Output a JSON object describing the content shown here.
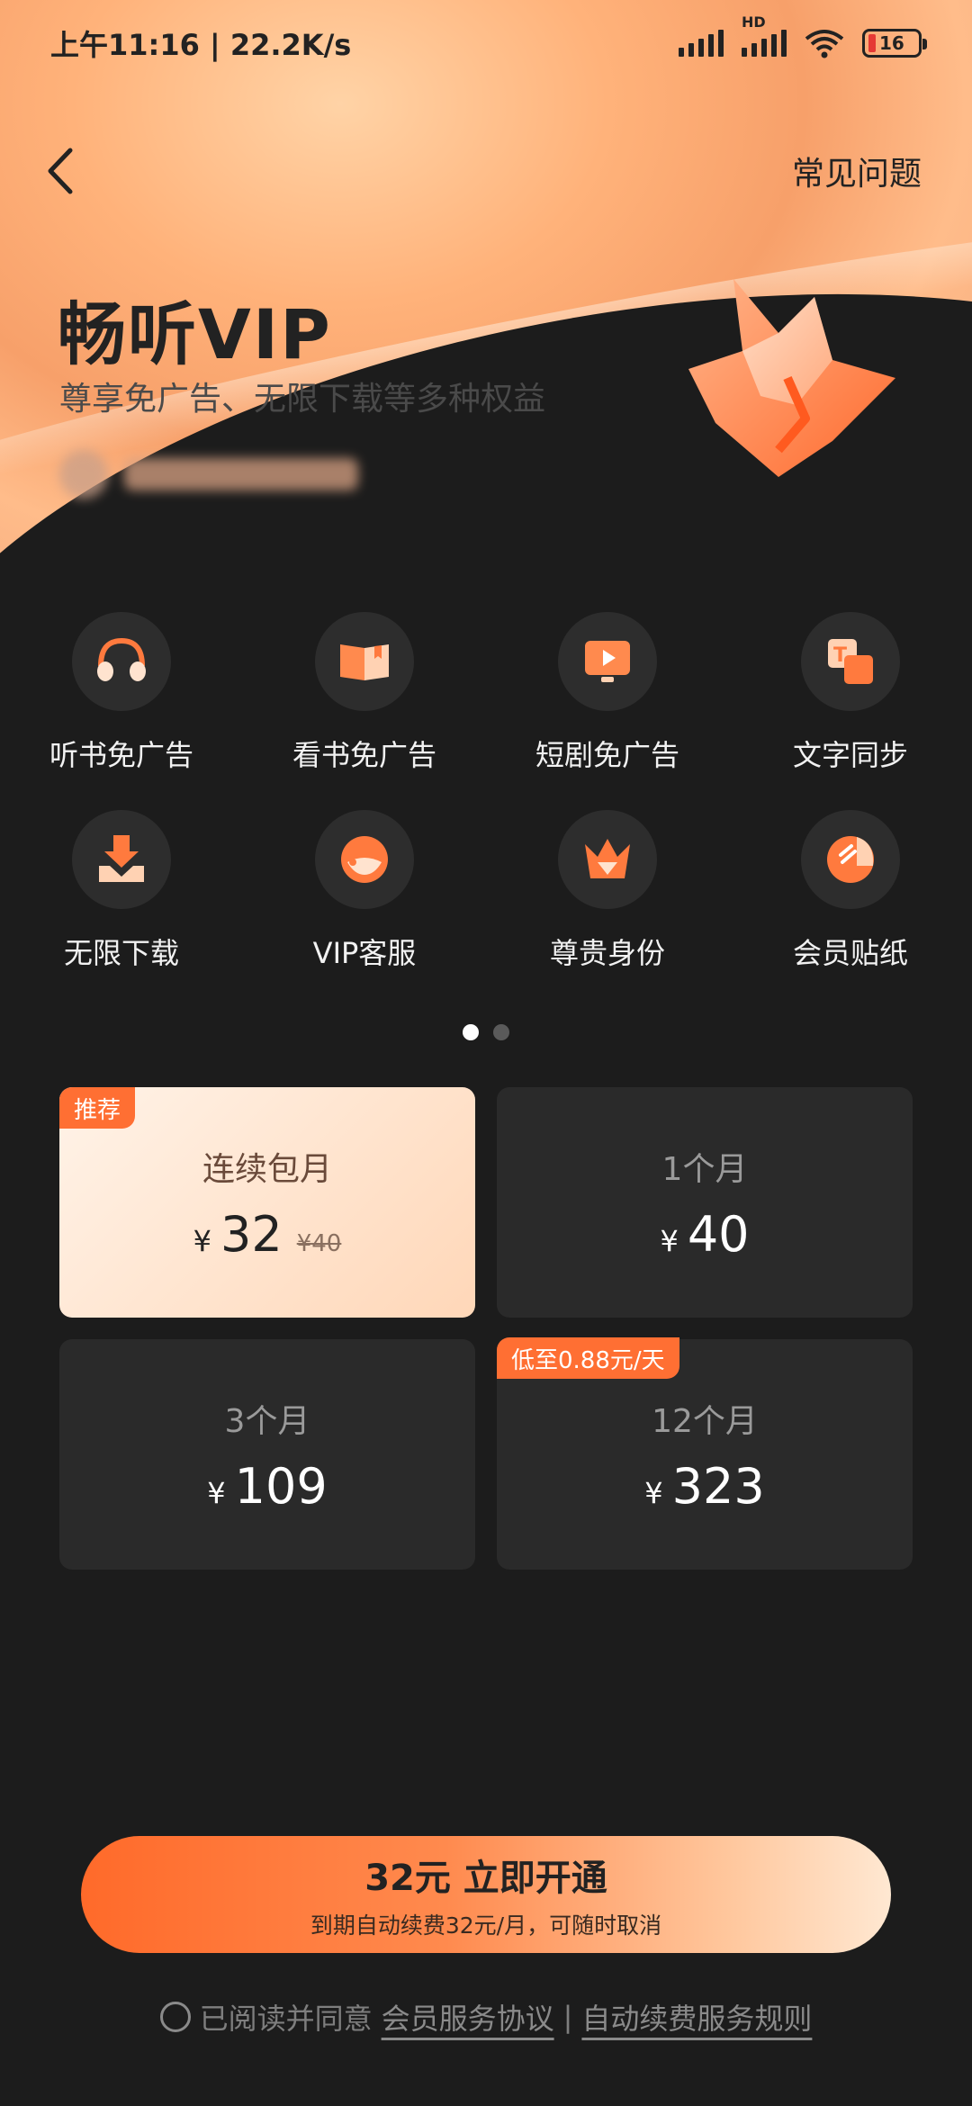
{
  "status_bar": {
    "time": "上午11:16 | 22.2K/s",
    "hd": "HD",
    "battery": "16"
  },
  "nav": {
    "faq_label": "常见问题"
  },
  "hero": {
    "title": "畅听VIP",
    "subtitle": "尊享免广告、无限下载等多种权益"
  },
  "benefits": [
    {
      "label": "听书免广告",
      "icon": "headphones-icon"
    },
    {
      "label": "看书免广告",
      "icon": "book-icon"
    },
    {
      "label": "短剧免广告",
      "icon": "tv-play-icon"
    },
    {
      "label": "文字同步",
      "icon": "text-sync-icon"
    },
    {
      "label": "无限下载",
      "icon": "download-icon"
    },
    {
      "label": "VIP客服",
      "icon": "customer-service-icon"
    },
    {
      "label": "尊贵身份",
      "icon": "crown-icon"
    },
    {
      "label": "会员贴纸",
      "icon": "sticker-icon"
    }
  ],
  "pager": {
    "pages": 2,
    "active": 1
  },
  "plans": [
    {
      "name": "连续包月",
      "currency": "¥",
      "price": "32",
      "original": "¥40",
      "tag": "推荐",
      "selected": true
    },
    {
      "name": "1个月",
      "currency": "¥",
      "price": "40",
      "selected": false
    },
    {
      "name": "3个月",
      "currency": "¥",
      "price": "109",
      "selected": false
    },
    {
      "name": "12个月",
      "currency": "¥",
      "price": "323",
      "tag": "低至0.88元/天",
      "selected": false
    }
  ],
  "cta": {
    "main": "32元 立即开通",
    "sub": "到期自动续费32元/月，可随时取消"
  },
  "agreement": {
    "text": "已阅读并同意",
    "link1": "会员服务协议",
    "separator": "|",
    "link2": "自动续费服务规则"
  },
  "colors": {
    "accent": "#ff6f33",
    "background": "#1c1c1c",
    "card": "#2a2a2a"
  }
}
